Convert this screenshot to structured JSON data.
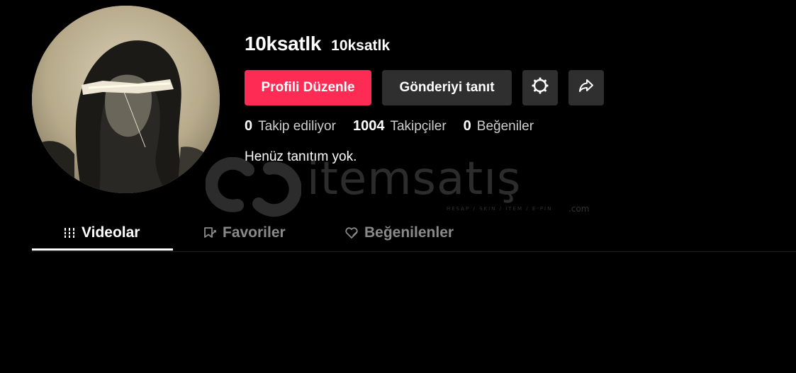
{
  "profile": {
    "display_name": "10ksatlk",
    "username": "10ksatlk",
    "bio": "Henüz tanıtım yok."
  },
  "actions": {
    "edit_profile": "Profili Düzenle",
    "promote_post": "Gönderiyi tanıt",
    "settings_icon": "gear-icon",
    "share_icon": "share-arrow-icon"
  },
  "stats": [
    {
      "value": "0",
      "label": "Takip ediliyor"
    },
    {
      "value": "1004",
      "label": "Takipçiler"
    },
    {
      "value": "0",
      "label": "Beğeniler"
    }
  ],
  "tabs": [
    {
      "label": "Videolar",
      "icon": "grid-lines-icon",
      "active": true
    },
    {
      "label": "Favoriler",
      "icon": "bookmark-icon",
      "active": false
    },
    {
      "label": "Beğenilenler",
      "icon": "heart-icon",
      "active": false
    }
  ],
  "watermark": {
    "text": "itemsatış",
    "subtitle": "HESAP / SKIN / ITEM / E-PIN",
    "suffix": ".com"
  },
  "colors": {
    "background": "#000000",
    "primary_button": "#fe2c55",
    "secondary_button": "#2f2f2f",
    "inactive_tab": "#8a8a8a"
  }
}
